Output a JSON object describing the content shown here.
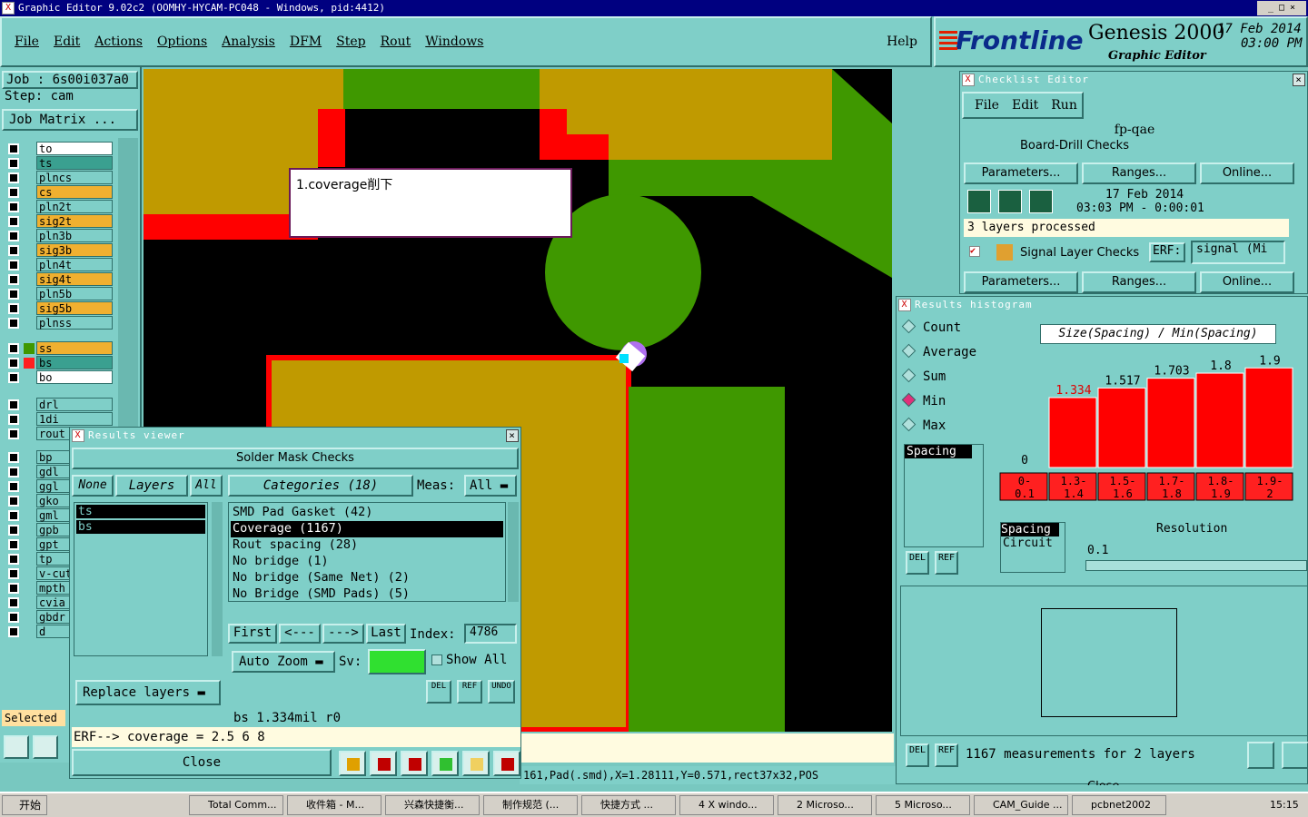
{
  "window_title": "Graphic Editor 9.02c2 (OOMHY-HYCAM-PC048 - Windows, pid:4412)",
  "menubar": [
    "File",
    "Edit",
    "Actions",
    "Options",
    "Analysis",
    "DFM",
    "Step",
    "Rout",
    "Windows"
  ],
  "help": "Help",
  "brand": {
    "logo": "Frontline",
    "product": "Genesis 2000",
    "subtitle": "Graphic Editor",
    "date": "17 Feb 2014",
    "time": "03:00 PM"
  },
  "job": {
    "job_label": "Job : 6s00i037a0",
    "step_label": "Step: cam",
    "matrix": "Job Matrix ..."
  },
  "layers": [
    "to",
    "ts",
    "plncs",
    "cs",
    "pln2t",
    "sig2t",
    "pln3b",
    "sig3b",
    "pln4t",
    "sig4t",
    "pln5b",
    "sig5b",
    "plnss",
    "ss",
    "bs",
    "bo",
    "drl",
    "1di",
    "rout",
    "bp",
    "gdl",
    "ggl",
    "gko",
    "gml",
    "gpb",
    "gpt",
    "tp",
    "v-cut",
    "mpth",
    "cvia",
    "gbdr",
    "d"
  ],
  "selected_label": "Selected",
  "callout": "1.coverage削下",
  "checklist": {
    "title": "Checklist Editor",
    "menu": [
      "File",
      "Edit",
      "Run"
    ],
    "name": "fp-qae",
    "row1": "Board-Drill Checks",
    "erf": "ERF:",
    "params": "Parameters...",
    "ranges": "Ranges...",
    "online": "Online...",
    "date": "17 Feb 2014",
    "time": "03:03 PM - 0:00:01",
    "processed": "3 layers processed",
    "row2": "Signal Layer Checks",
    "erf_val": "signal (Mi"
  },
  "histogram": {
    "title": "Results histogram",
    "modes": [
      "Count",
      "Average",
      "Sum",
      "Min",
      "Max"
    ],
    "header": "Size(Spacing) / Min(Spacing)",
    "bars": [
      {
        "label": "0",
        "range": "0- 0.1",
        "value": 0
      },
      {
        "label": "1.334",
        "range": "1.3- 1.4",
        "value": 1.334
      },
      {
        "label": "1.517",
        "range": "1.5- 1.6",
        "value": 1.517
      },
      {
        "label": "1.703",
        "range": "1.7- 1.8",
        "value": 1.703
      },
      {
        "label": "1.8",
        "range": "1.8- 1.9",
        "value": 1.8
      },
      {
        "label": "1.9",
        "range": "1.9- 2",
        "value": 1.9
      }
    ],
    "list1": "Spacing",
    "list2": [
      "Spacing",
      "Circuit"
    ],
    "resolution_label": "Resolution",
    "resolution": "0.1",
    "del": "DEL",
    "ref": "REF",
    "summary": "1167 measurements for 2 layers",
    "close": "Close"
  },
  "results": {
    "title": "Results viewer",
    "header": "Solder Mask Checks",
    "none": "None",
    "layers": "Layers",
    "all": "All",
    "categories": "Categories (18)",
    "meas": "Meas:",
    "meas_val": "All",
    "layer_list": [
      "ts",
      "bs"
    ],
    "items": [
      "SMD Pad Gasket (42)",
      "Coverage (1167)",
      "Rout spacing (28)",
      "No bridge (1)",
      "No bridge (Same Net) (2)",
      "No Bridge (SMD Pads) (5)"
    ],
    "first": "First",
    "prev": "<---",
    "next": "--->",
    "last": "Last",
    "index_label": "Index:",
    "index": "4786",
    "autozoom": "Auto Zoom",
    "sv": "Sv:",
    "showall": "Show All",
    "replace": "Replace layers",
    "del": "DEL",
    "ref": "REF",
    "undo": "UNDO",
    "status": "bs 1.334mil r0",
    "erf": "ERF--> coverage = 2.5 6 8",
    "close": "Close"
  },
  "statusbar": "161,Pad(.smd),X=1.28111,Y=0.571,rect37x32,POS",
  "taskbar": {
    "start": "开始",
    "items": [
      "Total Comm...",
      "收件箱 - M...",
      "兴森快捷衡...",
      "制作规范 (...",
      "快捷方式 ...",
      "4 X windo...",
      "2 Microso...",
      "5 Microso...",
      "CAM_Guide ...",
      "pcbnet2002"
    ],
    "clock": "15:15"
  },
  "colors": {
    "teal": "#7fcfc8",
    "gold": "#c09a00",
    "green": "#3f9800",
    "red": "#ff0000",
    "black": "#000000"
  }
}
